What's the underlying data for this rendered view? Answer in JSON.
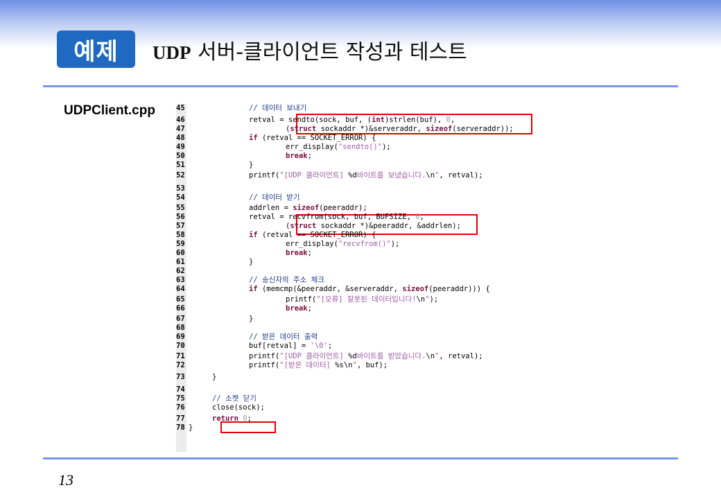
{
  "header": {
    "badge": "예제",
    "title_lead": "UDP",
    "title_rest": " 서버-클라이언트 작성과 테스트"
  },
  "file_label": "UDPClient.cpp",
  "page_number": "13",
  "code_lines": [
    {
      "n": "45",
      "indent": 2,
      "parts": [
        [
          "cmt",
          "// 데이터 보내기"
        ]
      ]
    },
    {
      "n": "46",
      "indent": 2,
      "parts": [
        [
          "",
          "retval = sendto(sock, buf, ("
        ],
        [
          "kw",
          "int"
        ],
        [
          "",
          ")strlen(buf), "
        ],
        [
          "num",
          "0"
        ],
        [
          "",
          ","
        ]
      ]
    },
    {
      "n": "47",
      "indent": 3,
      "parts": [
        [
          "",
          "("
        ],
        [
          "kw",
          "struct"
        ],
        [
          "",
          " sockaddr *)&serveraddr, "
        ],
        [
          "kw",
          "sizeof"
        ],
        [
          "",
          "(serveraddr));"
        ]
      ]
    },
    {
      "n": "48",
      "indent": 2,
      "parts": [
        [
          "kw",
          "if"
        ],
        [
          "",
          " (retval == SOCKET_ERROR) {"
        ]
      ]
    },
    {
      "n": "49",
      "indent": 3,
      "parts": [
        [
          "",
          "err_display("
        ],
        [
          "str",
          "\"sendto()\""
        ],
        [
          "",
          ");"
        ]
      ]
    },
    {
      "n": "50",
      "indent": 3,
      "parts": [
        [
          "kw",
          "break"
        ],
        [
          "",
          ";"
        ]
      ]
    },
    {
      "n": "51",
      "indent": 2,
      "parts": [
        [
          "",
          "}"
        ]
      ]
    },
    {
      "n": "52",
      "indent": 2,
      "parts": [
        [
          "",
          "printf("
        ],
        [
          "str",
          "\"[UDP 클라이언트] "
        ],
        [
          "",
          "%d"
        ],
        [
          "str",
          "바이트를 보냈습니다."
        ],
        [
          "",
          "\\n"
        ],
        [
          "str",
          "\""
        ],
        [
          "",
          ", retval);"
        ]
      ]
    },
    {
      "n": "53",
      "indent": 0,
      "parts": []
    },
    {
      "n": "54",
      "indent": 2,
      "parts": [
        [
          "cmt",
          "// 데이터 받기"
        ]
      ]
    },
    {
      "n": "55",
      "indent": 2,
      "parts": [
        [
          "",
          "addrlen = "
        ],
        [
          "kw",
          "sizeof"
        ],
        [
          "",
          "(peeraddr);"
        ]
      ]
    },
    {
      "n": "56",
      "indent": 2,
      "parts": [
        [
          "",
          "retval = recvfrom(sock, buf, BUFSIZE, "
        ],
        [
          "num",
          "0"
        ],
        [
          "",
          ","
        ]
      ]
    },
    {
      "n": "57",
      "indent": 3,
      "parts": [
        [
          "",
          "("
        ],
        [
          "kw",
          "struct"
        ],
        [
          "",
          " sockaddr *)&peeraddr, &addrlen);"
        ]
      ]
    },
    {
      "n": "58",
      "indent": 2,
      "parts": [
        [
          "kw",
          "if"
        ],
        [
          "",
          " (retval == SOCKET_ERROR) {"
        ]
      ]
    },
    {
      "n": "59",
      "indent": 3,
      "parts": [
        [
          "",
          "err_display("
        ],
        [
          "str",
          "\"recvfrom()\""
        ],
        [
          "",
          ");"
        ]
      ]
    },
    {
      "n": "60",
      "indent": 3,
      "parts": [
        [
          "kw",
          "break"
        ],
        [
          "",
          ";"
        ]
      ]
    },
    {
      "n": "61",
      "indent": 2,
      "parts": [
        [
          "",
          "}"
        ]
      ]
    },
    {
      "n": "62",
      "indent": 0,
      "parts": []
    },
    {
      "n": "63",
      "indent": 2,
      "parts": [
        [
          "cmt",
          "// 송신자의 주소 체크"
        ]
      ]
    },
    {
      "n": "64",
      "indent": 2,
      "parts": [
        [
          "kw",
          "if"
        ],
        [
          "",
          " (memcmp(&peeraddr, &serveraddr, "
        ],
        [
          "kw",
          "sizeof"
        ],
        [
          "",
          "(peeraddr))) {"
        ]
      ]
    },
    {
      "n": "65",
      "indent": 3,
      "parts": [
        [
          "",
          "printf("
        ],
        [
          "str",
          "\"[오류] 잘못된 데이터입니다!"
        ],
        [
          "",
          "\\n"
        ],
        [
          "str",
          "\""
        ],
        [
          "",
          ");"
        ]
      ]
    },
    {
      "n": "66",
      "indent": 3,
      "parts": [
        [
          "kw",
          "break"
        ],
        [
          "",
          ";"
        ]
      ]
    },
    {
      "n": "67",
      "indent": 2,
      "parts": [
        [
          "",
          "}"
        ]
      ]
    },
    {
      "n": "68",
      "indent": 0,
      "parts": []
    },
    {
      "n": "69",
      "indent": 2,
      "parts": [
        [
          "cmt",
          "// 받은 데이터 출력"
        ]
      ]
    },
    {
      "n": "70",
      "indent": 2,
      "parts": [
        [
          "",
          "buf[retval] = "
        ],
        [
          "str",
          "'\\0'"
        ],
        [
          "",
          ";"
        ]
      ]
    },
    {
      "n": "71",
      "indent": 2,
      "parts": [
        [
          "",
          "printf("
        ],
        [
          "str",
          "\"[UDP 클라이언트] "
        ],
        [
          "",
          "%d"
        ],
        [
          "str",
          "바이트를 받았습니다."
        ],
        [
          "",
          "\\n"
        ],
        [
          "str",
          "\""
        ],
        [
          "",
          ", retval);"
        ]
      ]
    },
    {
      "n": "72",
      "indent": 2,
      "parts": [
        [
          "",
          "printf("
        ],
        [
          "str",
          "\"[받은 데이터] "
        ],
        [
          "",
          "%s\\n"
        ],
        [
          "str",
          "\""
        ],
        [
          "",
          ", buf);"
        ]
      ]
    },
    {
      "n": "73",
      "indent": 1,
      "parts": [
        [
          "",
          "}"
        ]
      ]
    },
    {
      "n": "74",
      "indent": 0,
      "parts": []
    },
    {
      "n": "75",
      "indent": 1,
      "parts": [
        [
          "cmt",
          "// 소켓 닫기"
        ]
      ]
    },
    {
      "n": "76",
      "indent": 1,
      "parts": [
        [
          "",
          "close(sock);"
        ]
      ]
    },
    {
      "n": "77",
      "indent": 1,
      "parts": [
        [
          "kw",
          "return"
        ],
        [
          "",
          " "
        ],
        [
          "num",
          "0"
        ],
        [
          "",
          ";"
        ]
      ]
    },
    {
      "n": "78",
      "indent": 0,
      "parts": [
        [
          "",
          "}"
        ]
      ]
    }
  ]
}
